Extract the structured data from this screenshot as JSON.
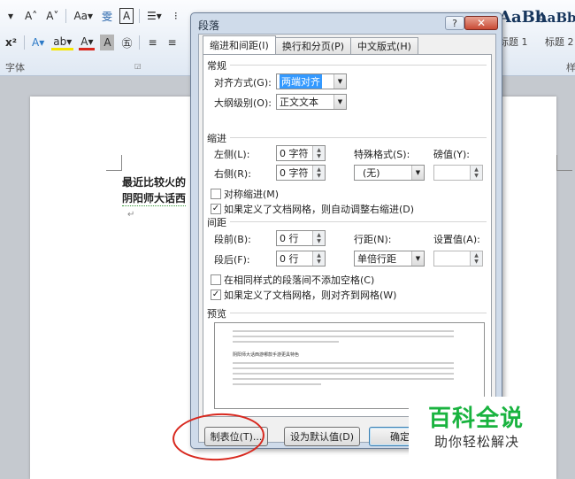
{
  "ribbon": {
    "row1": {
      "font_dropdown": "▾",
      "grow_font": "A˄",
      "shrink_font": "A˅",
      "change_case": "Aa▾",
      "phonetic": "㊫",
      "phonetic_guide": "雯",
      "char_border": "A",
      "bullets": "☰▾",
      "numbering": "⁝"
    },
    "row2": {
      "superscript": "x²",
      "text_effects": "A▾",
      "highlight": "ab▾",
      "font_color": "A▾",
      "char_shading": "A",
      "enclose": "㊄",
      "align_left": "≡",
      "align_center": "≡"
    },
    "font_group_label": "字体",
    "styles": [
      {
        "sample": "AaBb",
        "name": "标题 1"
      },
      {
        "sample": "AaBb",
        "name": "标题 2"
      }
    ],
    "right_group_label": "样"
  },
  "document": {
    "line1": "最近比较火的",
    "line2": "阴阳师大话西",
    "para_mark": "↵"
  },
  "dialog": {
    "title": "段落",
    "help": "?",
    "close": "✕",
    "tabs": [
      "缩进和间距(I)",
      "换行和分页(P)",
      "中文版式(H)"
    ],
    "general": {
      "heading": "常规",
      "alignment_label": "对齐方式(G):",
      "alignment_value": "两端对齐",
      "outline_label": "大纲级别(O):",
      "outline_value": "正文文本"
    },
    "indent": {
      "heading": "缩进",
      "left_label": "左侧(L):",
      "left_value": "0 字符",
      "right_label": "右侧(R):",
      "right_value": "0 字符",
      "special_label": "特殊格式(S):",
      "special_value": "(无)",
      "by_label": "磅值(Y):",
      "mirror_label": "对称缩进(M)",
      "mirror_checked": false,
      "auto_adjust_label": "如果定义了文档网格，则自动调整右缩进(D)",
      "auto_adjust_checked": true
    },
    "spacing": {
      "heading": "间距",
      "before_label": "段前(B):",
      "before_value": "0 行",
      "after_label": "段后(F):",
      "after_value": "0 行",
      "line_label": "行距(N):",
      "line_value": "单倍行距",
      "at_label": "设置值(A):",
      "no_space_label": "在相同样式的段落间不添加空格(C)",
      "no_space_checked": false,
      "snap_grid_label": "如果定义了文档网格，则对齐到网格(W)",
      "snap_grid_checked": true
    },
    "preview": {
      "heading": "预览",
      "sample_text": "阴阳师大话西游哪款手游更具特色"
    },
    "buttons": {
      "tabs": "制表位(T)...",
      "set_default": "设为默认值(D)",
      "ok": "确定"
    }
  },
  "watermark": {
    "title": "百科全说",
    "subtitle": "助你轻松解决"
  }
}
